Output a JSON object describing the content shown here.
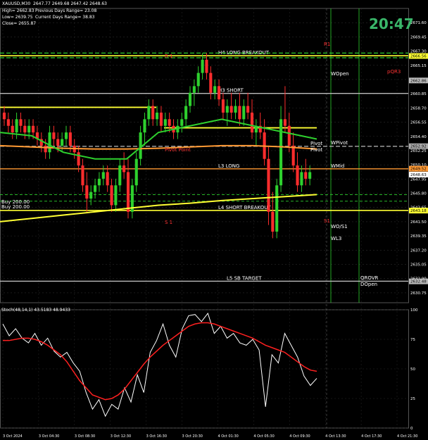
{
  "header": {
    "symbol": "XAUUSD,M30",
    "ohlc": "2647.77 2649.68 2647.42 2648.63",
    "high": "High= 2662.83",
    "prev_range": "Previous Days Range= 23.08",
    "low": "Low= 2639.75",
    "current_range": "Current Days Range= 38.83",
    "close": "Close= 2655.87"
  },
  "clock": "20:47",
  "stoch_label": "Stoch(48,14,1) 43.5183 48.9433",
  "colors": {
    "bull": "#2ed12e",
    "bear": "#ff2d2d",
    "yellow": "#ffff33",
    "orange": "#ff9933",
    "grid": "#2a2a2a"
  },
  "chart_data": [
    {
      "type": "line",
      "title": "XAUUSD,M30",
      "ylim": [
        2629.25,
        2673.75
      ],
      "y_ticks": [
        "2671.60",
        "2669.45",
        "2667.30",
        "2665.15",
        "2663.00",
        "2660.85",
        "2658.70",
        "2656.55",
        "2654.40",
        "2652.25",
        "2650.10",
        "2647.95",
        "2645.80",
        "2643.65",
        "2641.50",
        "2639.35",
        "2637.20",
        "2635.05",
        "2632.90",
        "2630.75"
      ],
      "x_ticks": [
        "3 Oct 2024",
        "3 Oct 04:30",
        "3 Oct 08:30",
        "3 Oct 12:30",
        "3 Oct 16:30",
        "3 Oct 20:30",
        "4 Oct 01:30",
        "4 Oct 05:30",
        "4 Oct 09:30",
        "4 Oct 13:30",
        "4 Oct 17:30",
        "4 Oct 21:30"
      ],
      "candles_ohlc": [
        [
          2658,
          2659,
          2656,
          2657
        ],
        [
          2657,
          2658,
          2655,
          2656
        ],
        [
          2656,
          2657,
          2654,
          2655
        ],
        [
          2655,
          2658,
          2654,
          2657
        ],
        [
          2657,
          2658,
          2655,
          2656
        ],
        [
          2656,
          2657,
          2654,
          2655
        ],
        [
          2655,
          2657,
          2654,
          2656
        ],
        [
          2656,
          2657,
          2654,
          2655
        ],
        [
          2655,
          2656,
          2653,
          2654
        ],
        [
          2654,
          2655,
          2652,
          2653
        ],
        [
          2653,
          2654,
          2651,
          2652
        ],
        [
          2652,
          2656,
          2651,
          2655
        ],
        [
          2655,
          2656,
          2653,
          2654
        ],
        [
          2654,
          2655,
          2652,
          2653
        ],
        [
          2653,
          2655,
          2652,
          2654
        ],
        [
          2654,
          2656,
          2653,
          2655
        ],
        [
          2655,
          2656,
          2652,
          2653
        ],
        [
          2653,
          2654,
          2651,
          2652
        ],
        [
          2652,
          2653,
          2649,
          2650
        ],
        [
          2650,
          2651,
          2646,
          2647
        ],
        [
          2647,
          2649,
          2643,
          2645
        ],
        [
          2645,
          2647,
          2644,
          2646
        ],
        [
          2646,
          2648,
          2645,
          2647
        ],
        [
          2647,
          2649,
          2646,
          2648
        ],
        [
          2648,
          2650,
          2647,
          2649
        ],
        [
          2649,
          2650,
          2646,
          2647
        ],
        [
          2647,
          2648,
          2643,
          2644
        ],
        [
          2644,
          2648,
          2643,
          2647
        ],
        [
          2647,
          2651,
          2646,
          2650
        ],
        [
          2650,
          2652,
          2648,
          2649
        ],
        [
          2649,
          2651,
          2642,
          2643
        ],
        [
          2643,
          2648,
          2642,
          2647
        ],
        [
          2647,
          2652,
          2646,
          2651
        ],
        [
          2651,
          2656,
          2650,
          2655
        ],
        [
          2655,
          2658,
          2653,
          2657
        ],
        [
          2657,
          2660,
          2656,
          2659
        ],
        [
          2659,
          2660,
          2656,
          2657
        ],
        [
          2657,
          2659,
          2656,
          2658
        ],
        [
          2658,
          2659,
          2655,
          2656
        ],
        [
          2656,
          2658,
          2655,
          2657
        ],
        [
          2657,
          2658,
          2655,
          2656
        ],
        [
          2656,
          2657,
          2654,
          2655
        ],
        [
          2655,
          2657,
          2654,
          2656
        ],
        [
          2656,
          2658,
          2655,
          2657
        ],
        [
          2657,
          2660,
          2656,
          2659
        ],
        [
          2659,
          2662,
          2658,
          2661
        ],
        [
          2661,
          2663,
          2659,
          2662
        ],
        [
          2662,
          2665,
          2661,
          2664
        ],
        [
          2664,
          2667,
          2663,
          2666
        ],
        [
          2666,
          2667,
          2663,
          2664
        ],
        [
          2664,
          2665,
          2660,
          2661
        ],
        [
          2661,
          2663,
          2660,
          2662
        ],
        [
          2662,
          2663,
          2659,
          2660
        ],
        [
          2660,
          2661,
          2657,
          2658
        ],
        [
          2658,
          2660,
          2656,
          2659
        ],
        [
          2659,
          2661,
          2657,
          2658
        ],
        [
          2658,
          2660,
          2657,
          2659
        ],
        [
          2659,
          2661,
          2656,
          2657
        ],
        [
          2657,
          2660,
          2656,
          2659
        ],
        [
          2659,
          2661,
          2657,
          2658
        ],
        [
          2658,
          2660,
          2654,
          2655
        ],
        [
          2655,
          2657,
          2653,
          2656
        ],
        [
          2656,
          2658,
          2654,
          2655
        ],
        [
          2655,
          2657,
          2650,
          2651
        ],
        [
          2651,
          2653,
          2641,
          2643
        ],
        [
          2643,
          2646,
          2639,
          2640
        ],
        [
          2640,
          2648,
          2639,
          2647
        ],
        [
          2647,
          2659,
          2646,
          2657
        ],
        [
          2657,
          2662,
          2655,
          2656
        ],
        [
          2656,
          2658,
          2652,
          2653
        ],
        [
          2653,
          2655,
          2649,
          2650
        ],
        [
          2650,
          2652,
          2646,
          2647
        ],
        [
          2647,
          2650,
          2646,
          2649
        ],
        [
          2649,
          2651,
          2647,
          2648
        ],
        [
          2648,
          2650,
          2647,
          2649
        ]
      ],
      "moving_averages": [
        {
          "color": "#ffff33",
          "values": [
            2641.5,
            2642,
            2642.5,
            2643,
            2643.5,
            2644,
            2644.3,
            2644.7,
            2645,
            2645.3,
            2645.6
          ]
        },
        {
          "color": "#ff9933",
          "values": [
            2653,
            2652.8,
            2652.6,
            2652.5,
            2652.5,
            2652.6,
            2652.8,
            2653,
            2653,
            2652.8,
            2652.5
          ]
        },
        {
          "color": "#2ed12e",
          "values": [
            2655,
            2654.5,
            2652,
            2651,
            2651,
            2655,
            2656,
            2657,
            2656,
            2655,
            2654
          ]
        }
      ],
      "levels": [
        {
          "label": "H4 LONG BREAKOUT",
          "value": 2666.6,
          "color": "#ffff33"
        },
        {
          "label": "H3 SHORT",
          "value": 2660.9,
          "color": "#bbbbbb"
        },
        {
          "label": "L3 LONG",
          "value": 2649.5,
          "color": "#ff9933"
        },
        {
          "label": "L4 SHORT BREAKOUT",
          "value": 2643.2,
          "color": "#ffff33"
        },
        {
          "label": "L5 SB TARGET",
          "value": 2632.5,
          "color": "#bbbbbb"
        },
        {
          "label": "Pivot",
          "value": 2652.9,
          "color": "#aaaaaa"
        }
      ],
      "price_tags": [
        "2666.56",
        "2662.86",
        "2652.92",
        "2649.52",
        "2648.63",
        "2643.18",
        "2632.48"
      ],
      "annotations": [
        "WOpen",
        "pQR3",
        "WPivot",
        "Pivot",
        "WMid",
        "WO/S1",
        "WL3",
        "QROVR",
        "DOpen",
        "R 1",
        "S 1",
        "Pivot Point",
        "R1",
        "S1",
        "Buy 200.00",
        "Buy 200.00"
      ]
    },
    {
      "type": "line",
      "title": "Stoch(48,14,1) 43.5183 48.9433",
      "ylim": [
        0,
        100
      ],
      "y_ticks": [
        "100",
        "75",
        "50",
        "25",
        "0"
      ],
      "series": [
        {
          "color": "#ffffff",
          "values": [
            88,
            78,
            84,
            76,
            72,
            80,
            70,
            76,
            65,
            60,
            64,
            55,
            48,
            30,
            16,
            24,
            10,
            20,
            16,
            34,
            22,
            45,
            30,
            64,
            74,
            88,
            70,
            60,
            84,
            95,
            96,
            90,
            97,
            80,
            86,
            76,
            80,
            72,
            70,
            75,
            66,
            18,
            62,
            55,
            80,
            70,
            60,
            44,
            36,
            42
          ]
        },
        {
          "color": "#ff2020",
          "values": [
            74,
            74,
            75,
            76,
            76,
            75,
            73,
            70,
            66,
            62,
            56,
            48,
            40,
            34,
            28,
            26,
            24,
            25,
            28,
            33,
            40,
            47,
            54,
            60,
            65,
            70,
            74,
            78,
            82,
            86,
            88,
            89,
            89,
            88,
            86,
            84,
            82,
            80,
            78,
            76,
            73,
            70,
            68,
            66,
            64,
            60,
            56,
            52,
            49,
            48
          ]
        }
      ]
    }
  ]
}
